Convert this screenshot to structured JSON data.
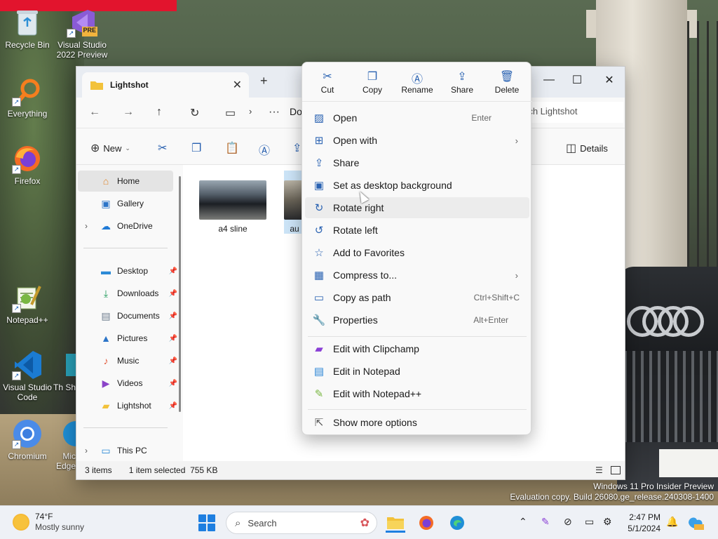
{
  "desktop": {
    "icons": [
      {
        "label": "Recycle Bin",
        "icon": "recycle-bin-icon"
      },
      {
        "label": "Visual Studio 2022 Preview",
        "icon": "visual-studio-preview-icon",
        "badge": "PRE"
      },
      {
        "label": "Everything",
        "icon": "everything-search-icon"
      },
      {
        "label": "Firefox",
        "icon": "firefox-icon"
      },
      {
        "label": "Notepad++",
        "icon": "notepad-plus-plus-icon"
      },
      {
        "label": "Visual Studio Code",
        "icon": "vscode-icon"
      },
      {
        "label": "Th Sh",
        "icon": "partial-app-icon"
      },
      {
        "label": "Chromium",
        "icon": "chromium-icon"
      },
      {
        "label": "Mic Edge",
        "icon": "edge-icon"
      }
    ]
  },
  "explorer": {
    "tab_title": "Lightshot",
    "breadcrumb": "Do",
    "search_placeholder": "rch Lightshot",
    "toolbar": {
      "new_label": "New",
      "details_label": "Details"
    },
    "sidebar": {
      "items": [
        {
          "label": "Home",
          "icon": "home-icon",
          "selected": true
        },
        {
          "label": "Gallery",
          "icon": "gallery-icon"
        },
        {
          "label": "OneDrive",
          "icon": "onedrive-icon",
          "expandable": true
        },
        {
          "label": "Desktop",
          "icon": "desktop-folder-icon",
          "pinned": true
        },
        {
          "label": "Downloads",
          "icon": "downloads-icon",
          "pinned": true
        },
        {
          "label": "Documents",
          "icon": "documents-icon",
          "pinned": true
        },
        {
          "label": "Pictures",
          "icon": "pictures-icon",
          "pinned": true
        },
        {
          "label": "Music",
          "icon": "music-icon",
          "pinned": true
        },
        {
          "label": "Videos",
          "icon": "videos-icon",
          "pinned": true
        },
        {
          "label": "Lightshot",
          "icon": "folder-icon",
          "pinned": true
        },
        {
          "label": "This PC",
          "icon": "this-pc-icon",
          "expandable": true
        }
      ]
    },
    "files": [
      {
        "name": "a4 sline",
        "selected": false
      },
      {
        "name": "au",
        "selected": true
      }
    ],
    "status": {
      "count": "3 items",
      "selection": "1 item selected",
      "size": "755 KB"
    }
  },
  "context_menu": {
    "actions": [
      {
        "label": "Cut",
        "icon": "scissors-icon"
      },
      {
        "label": "Copy",
        "icon": "copy-icon"
      },
      {
        "label": "Rename",
        "icon": "rename-icon"
      },
      {
        "label": "Share",
        "icon": "share-icon"
      },
      {
        "label": "Delete",
        "icon": "trash-icon"
      }
    ],
    "items": [
      {
        "label": "Open",
        "shortcut": "Enter",
        "icon": "open-image-icon"
      },
      {
        "label": "Open with",
        "submenu": true,
        "icon": "open-with-icon"
      },
      {
        "label": "Share",
        "icon": "share-icon"
      },
      {
        "label": "Set as desktop background",
        "icon": "desktop-background-icon"
      },
      {
        "label": "Rotate right",
        "icon": "rotate-right-icon",
        "hover": true
      },
      {
        "label": "Rotate left",
        "icon": "rotate-left-icon"
      },
      {
        "label": "Add to Favorites",
        "icon": "star-icon"
      },
      {
        "label": "Compress to...",
        "submenu": true,
        "icon": "compress-icon"
      },
      {
        "label": "Copy as path",
        "shortcut": "Ctrl+Shift+C",
        "icon": "copy-path-icon"
      },
      {
        "label": "Properties",
        "shortcut": "Alt+Enter",
        "icon": "wrench-icon"
      },
      {
        "label": "Edit with Clipchamp",
        "icon": "clipchamp-icon"
      },
      {
        "label": "Edit in Notepad",
        "icon": "notepad-icon"
      },
      {
        "label": "Edit with Notepad++",
        "icon": "notepad-plus-plus-icon"
      },
      {
        "label": "Show more options",
        "icon": "more-options-icon"
      }
    ]
  },
  "watermark": {
    "line1": "Windows 11 Pro Insider Preview",
    "line2": "Evaluation copy. Build 26080.ge_release.240308-1400"
  },
  "taskbar": {
    "weather_temp": "74°F",
    "weather_desc": "Mostly sunny",
    "search_placeholder": "Search",
    "time": "2:47 PM",
    "date": "5/1/2024",
    "accent": "#1e7fe0"
  }
}
